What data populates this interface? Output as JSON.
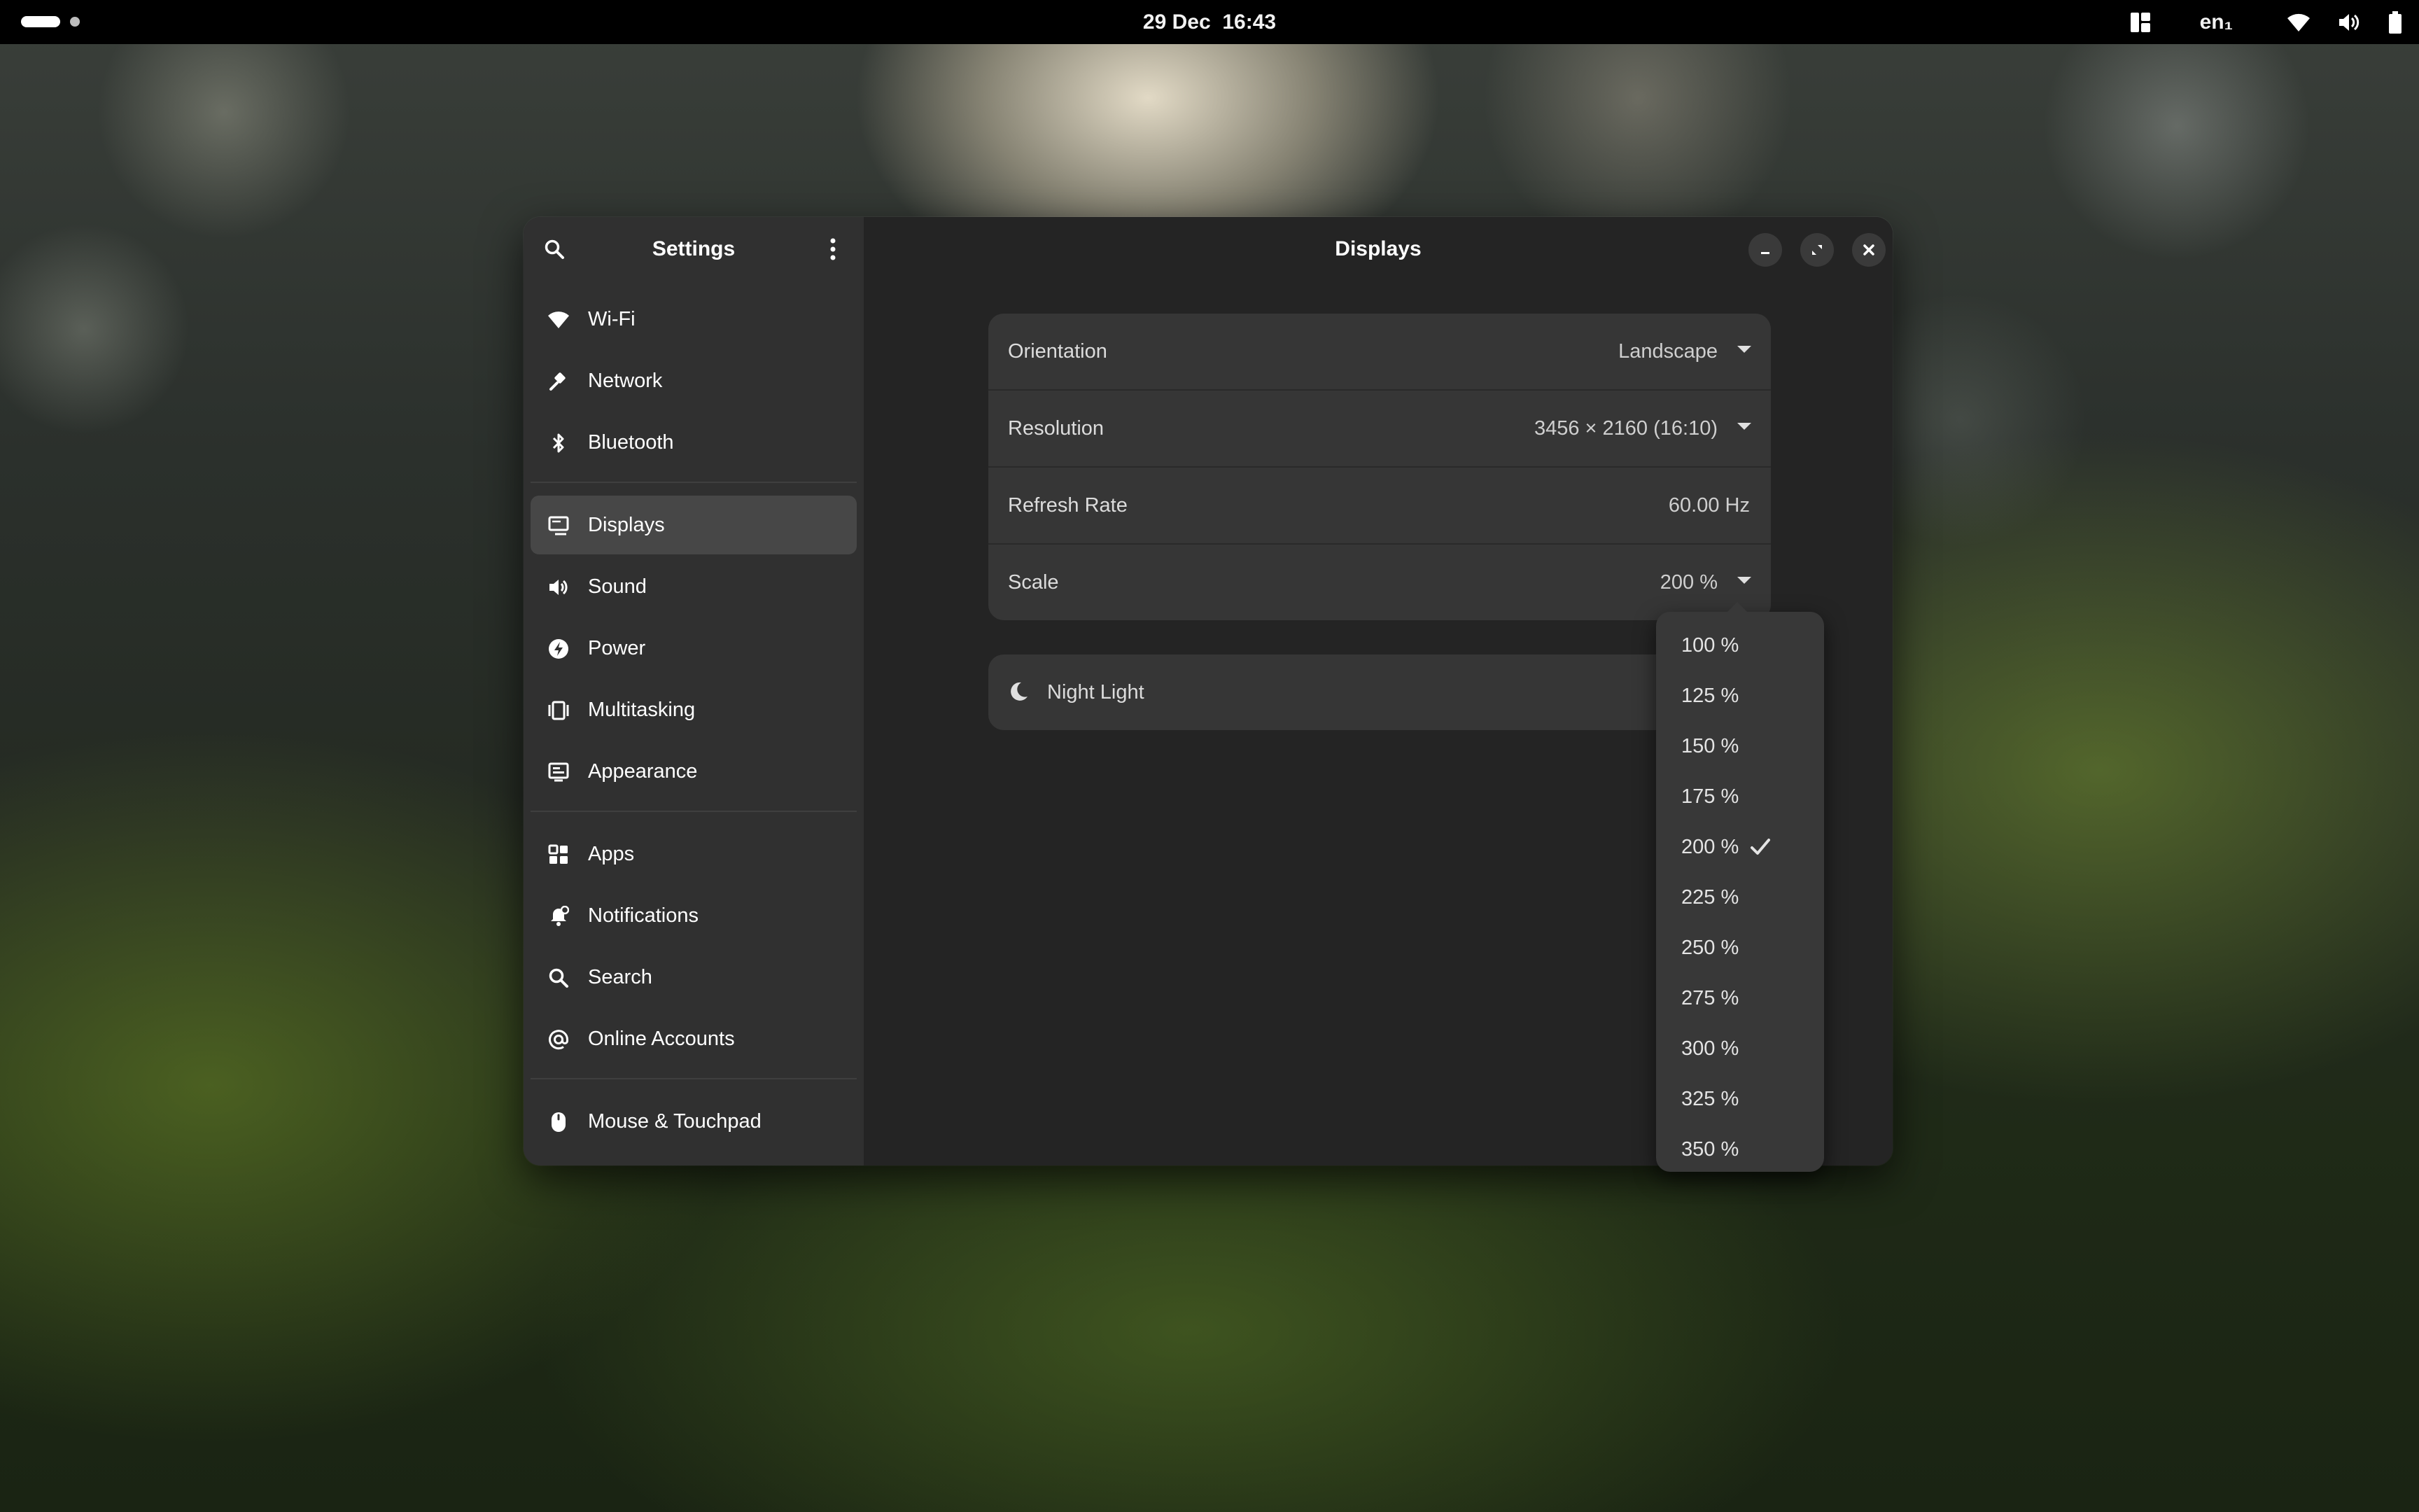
{
  "topbar": {
    "date": "29 Dec",
    "time": "16:43",
    "language": "en₁"
  },
  "sidebar": {
    "title": "Settings",
    "items": [
      {
        "label": "Wi-Fi"
      },
      {
        "label": "Network"
      },
      {
        "label": "Bluetooth"
      },
      {
        "label": "Displays",
        "active": true
      },
      {
        "label": "Sound"
      },
      {
        "label": "Power"
      },
      {
        "label": "Multitasking"
      },
      {
        "label": "Appearance"
      },
      {
        "label": "Apps"
      },
      {
        "label": "Notifications"
      },
      {
        "label": "Search"
      },
      {
        "label": "Online Accounts"
      },
      {
        "label": "Mouse & Touchpad"
      }
    ]
  },
  "displays": {
    "title": "Displays",
    "rows": [
      {
        "label": "Orientation",
        "value": "Landscape"
      },
      {
        "label": "Resolution",
        "value": "3456 × 2160 (16:10)"
      },
      {
        "label": "Refresh Rate",
        "value": "60.00 Hz"
      },
      {
        "label": "Scale",
        "value": "200 %"
      }
    ],
    "night_light": "Night Light"
  },
  "scale_popover": {
    "options": [
      "100 %",
      "125 %",
      "150 %",
      "175 %",
      "200 %",
      "225 %",
      "250 %",
      "275 %",
      "300 %",
      "325 %",
      "350 %"
    ],
    "selected": "200 %"
  },
  "colors": {
    "accent": "#ffffff",
    "window_bg": "#242424",
    "sidebar_bg": "#303030",
    "card_bg": "#363636"
  }
}
